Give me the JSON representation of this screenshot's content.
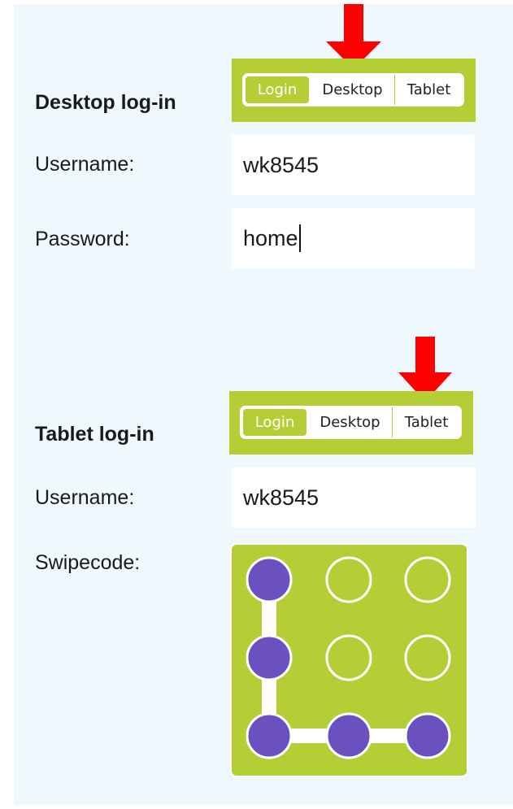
{
  "desktop": {
    "heading": "Desktop log-in",
    "username_label": "Username:",
    "username_value": "wk8545",
    "password_label": "Password:",
    "password_value": "home",
    "switcher": {
      "options": [
        "Login",
        "Desktop",
        "Tablet"
      ],
      "active": "Login",
      "pointed": "Desktop"
    }
  },
  "tablet": {
    "heading": "Tablet log-in",
    "username_label": "Username:",
    "username_value": "wk8545",
    "swipecode_label": "Swipecode:",
    "switcher": {
      "options": [
        "Login",
        "Desktop",
        "Tablet"
      ],
      "active": "Login",
      "pointed": "Tablet"
    },
    "swipe_pattern": {
      "grid": "3x3",
      "selected": [
        [
          0,
          0
        ],
        [
          1,
          0
        ],
        [
          2,
          0
        ],
        [
          2,
          1
        ],
        [
          2,
          2
        ]
      ],
      "colors": {
        "pad": "#b3cf35",
        "selected_dot": "#6b50c0",
        "ring": "#ffffff",
        "path": "#ffffff"
      }
    }
  },
  "colors": {
    "accent": "#b3cf35",
    "arrow": "#ff0000",
    "panel_bg": "#eef8fd"
  },
  "icons": {
    "arrow": "down-arrow-icon"
  }
}
